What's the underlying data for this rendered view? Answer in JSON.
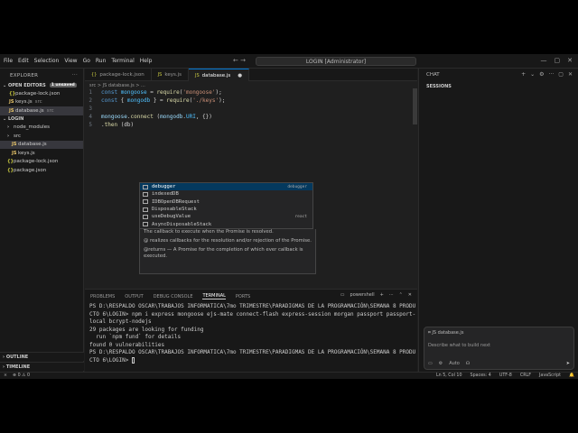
{
  "menu": [
    "File",
    "Edit",
    "Selection",
    "View",
    "Go",
    "Run",
    "Terminal",
    "Help"
  ],
  "search": {
    "text": "LOGIN [Administrator]"
  },
  "nav": {
    "back": "←",
    "forward": "→"
  },
  "window_controls": {
    "minimize": "—",
    "maximize": "▢",
    "close": "✕"
  },
  "sidebar": {
    "title": "EXPLORER",
    "open_editors": "OPEN EDITORS",
    "unsaved": "1 unsaved",
    "open_files": [
      {
        "icon": "{}",
        "name": "package-lock.json",
        "suffix": ""
      },
      {
        "icon": "JS",
        "name": "keys.js",
        "suffix": "src"
      },
      {
        "icon": "JS",
        "name": "database.js",
        "suffix": "src"
      }
    ],
    "project": "LOGIN",
    "tree": [
      {
        "type": "folder",
        "name": "node_modules",
        "indent": 1
      },
      {
        "type": "folder",
        "name": "src",
        "indent": 1
      },
      {
        "type": "js",
        "name": "database.js",
        "indent": 2,
        "active": true
      },
      {
        "type": "js",
        "name": "keys.js",
        "indent": 2
      },
      {
        "type": "json",
        "name": "package-lock.json",
        "indent": 1
      },
      {
        "type": "json",
        "name": "package.json",
        "indent": 1
      }
    ],
    "outline": "OUTLINE",
    "timeline": "TIMELINE"
  },
  "tabs": [
    {
      "icon": "{}",
      "label": "package-lock.json",
      "active": false
    },
    {
      "icon": "JS",
      "label": "keys.js",
      "active": false
    },
    {
      "icon": "JS",
      "label": "database.js",
      "active": true,
      "close": "●"
    }
  ],
  "breadcrumb": "src > JS database.js > ...",
  "code_lines": [
    {
      "n": "1",
      "html": "<span class='kw'>const</span> <span class='var'>mongoose</span> = <span class='fn'>require</span>(<span class='str'>'mongoose'</span>);"
    },
    {
      "n": "2",
      "html": "<span class='kw'>const</span> { <span class='var'>mongodb</span> } = <span class='fn'>require</span>(<span class='str'>'./keys'</span>);"
    },
    {
      "n": "3",
      "html": ""
    },
    {
      "n": "4",
      "html": "<span class='id'>mongoose</span>.<span class='fn'>connect</span> (<span class='id'>mongodb</span>.<span class='var'>URI</span>, {})"
    },
    {
      "n": "5",
      "html": ".<span class='fn'>then</span> (db)"
    }
  ],
  "suggest": [
    {
      "label": "debugger",
      "detail": "debugger",
      "selected": true
    },
    {
      "label": "indexedDB",
      "detail": ""
    },
    {
      "label": "IDBOpenDBRequest",
      "detail": ""
    },
    {
      "label": "DisposableStack",
      "detail": ""
    },
    {
      "label": "useDebugValue",
      "detail": "react"
    },
    {
      "label": "AsyncDisposableStack",
      "detail": ""
    }
  ],
  "hover_doc": [
    "The callback to execute when the Promise is resolved.",
    "@ realizes callbacks for the resolution and/or rejection of the Promise.",
    "@returns — A Promise for the completion of which ever callback is executed."
  ],
  "panel": {
    "tabs": [
      "PROBLEMS",
      "OUTPUT",
      "DEBUG CONSOLE",
      "TERMINAL",
      "PORTS"
    ],
    "active_tab": "TERMINAL",
    "shell": "powershell",
    "terminal_lines": [
      "PS D:\\RESPALDO OSCAR\\TRABAJOS INFORMATICA\\7mo TRIMESTRE\\PARADIGMAS DE LA PROGRAMACIÓN\\SEMANA 8 PRODU",
      "CTO 6\\LOGIN> npm i express mongoose ejs-mate connect-flash express-session morgan passport passport-",
      "local bcrypt-nodejs",
      "29 packages are looking for funding",
      "  run `npm fund` for details",
      "",
      "found 0 vulnerabilities",
      "PS D:\\RESPALDO OSCAR\\TRABAJOS INFORMATICA\\7mo TRIMESTRE\\PARADIGMAS DE LA PROGRAMACIÓN\\SEMANA 8 PRODU",
      "CTO 6\\LOGIN> "
    ]
  },
  "chat": {
    "title": "CHAT",
    "sessions": "SESSIONS",
    "context": "JS database.js",
    "placeholder": "Describe what to build next",
    "mode": "Auto"
  },
  "status": {
    "position": "Ln 5, Col 10",
    "spaces": "Spaces: 4",
    "encoding": "UTF-8",
    "eol": "CRLF",
    "language": "JavaScript"
  }
}
